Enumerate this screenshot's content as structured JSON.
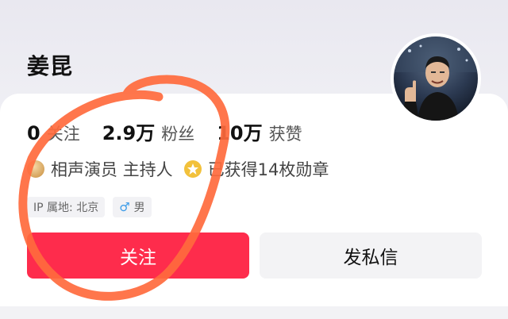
{
  "profile": {
    "name": "姜昆",
    "avatar_alt": "avatar"
  },
  "stats": [
    {
      "num": "0",
      "label": "关注"
    },
    {
      "num": "2.9万",
      "label": "粉丝"
    },
    {
      "num": "10万",
      "label": "获赞"
    }
  ],
  "badges": [
    {
      "icon": "medal-icon",
      "text": "相声演员 主持人"
    },
    {
      "icon": "star-icon",
      "text": "已获得14枚勋章"
    }
  ],
  "tags": {
    "ip": "IP 属地: 北京",
    "gender": "男",
    "gender_icon": "♂"
  },
  "actions": {
    "follow": "关注",
    "message": "发私信"
  },
  "colors": {
    "follow_button": "#fe2c4c",
    "annotation": "#ff6a3d"
  }
}
